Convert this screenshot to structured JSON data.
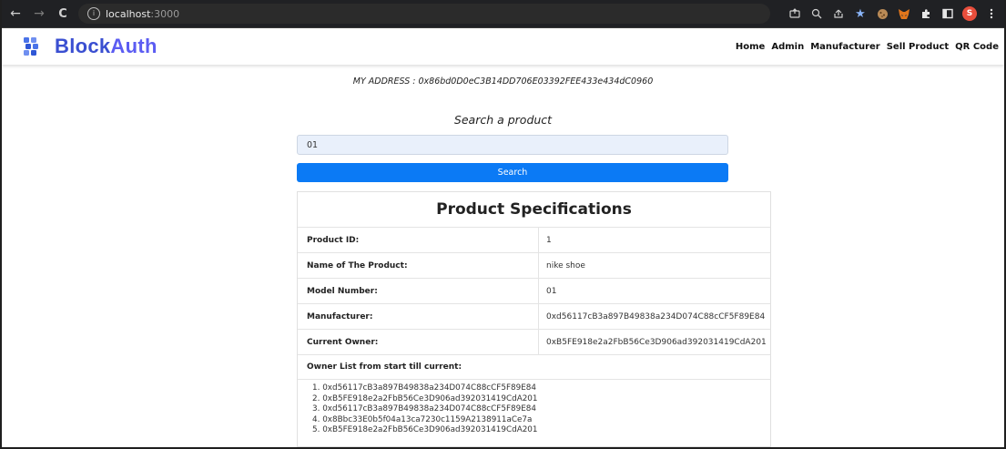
{
  "browser": {
    "url_host": "localhost",
    "url_port": ":3000",
    "nav": {
      "back": "←",
      "forward": "→",
      "reload": "C"
    },
    "info_glyph": "i",
    "profile_initial": "S",
    "extensions": [
      "share-icon",
      "zoom-icon",
      "share-page-icon",
      "bookmark-star-icon",
      "cookie-icon",
      "metamask-fox-icon",
      "puzzle-extensions-icon",
      "side-panel-icon",
      "profile-avatar-icon",
      "menu-kebab-icon"
    ]
  },
  "navbar": {
    "brand_part1": "Block",
    "brand_part2": "Auth",
    "links": {
      "home": "Home",
      "admin": "Admin",
      "manufacturer": "Manufacturer",
      "sell": "Sell Product",
      "qr": "QR Code"
    }
  },
  "address": {
    "text": "MY ADDRESS : 0x86bd0D0eC3B14DD706E03392FEE433e434dC0960"
  },
  "search": {
    "title": "Search a product",
    "value": "01",
    "button_label": "Search"
  },
  "specs": {
    "title": "Product Specifications",
    "rows": [
      {
        "label": "Product ID:",
        "value": "1"
      },
      {
        "label": "Name of The Product:",
        "value": "nike shoe"
      },
      {
        "label": "Model Number:",
        "value": "01"
      },
      {
        "label": "Manufacturer:",
        "value": "0xd56117cB3a897B49838a234D074C88cCF5F89E84"
      },
      {
        "label": "Current Owner:",
        "value": "0xB5FE918e2a2FbB56Ce3D906ad392031419CdA201"
      }
    ],
    "owner_list_label": "Owner List from start till current:",
    "owners": [
      "1. 0xd56117cB3a897B49838a234D074C88cCF5F89E84",
      "2. 0xB5FE918e2a2FbB56Ce3D906ad392031419CdA201",
      "3. 0xd56117cB3a897B49838a234D074C88cCF5F89E84",
      "4. 0x8Bbc33E0b5f04a13ca7230c1159A2138911aCe7a",
      "5. 0xB5FE918e2a2FbB56Ce3D906ad392031419CdA201"
    ]
  },
  "colors": {
    "brand_blue": "#3a4fd1",
    "brand_violet": "#5b5cf2",
    "button_blue": "#0b7af5",
    "input_bg": "#e9f0fb",
    "chrome_bg": "#202124"
  }
}
